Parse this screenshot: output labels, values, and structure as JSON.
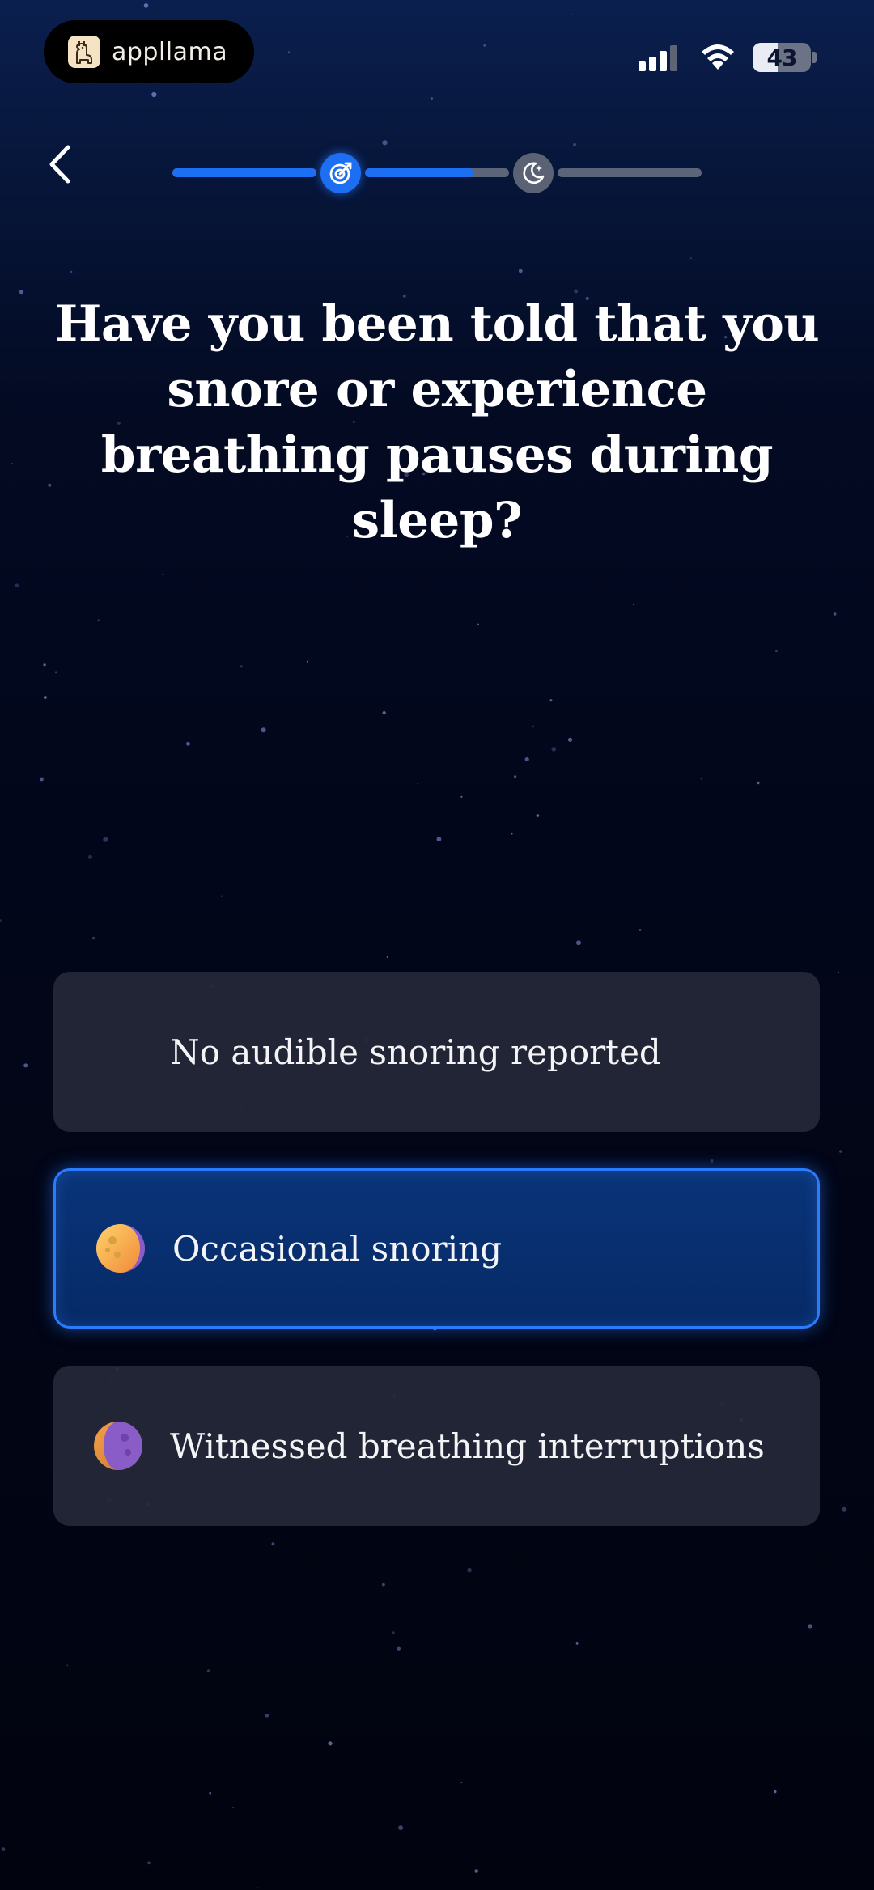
{
  "status_bar": {
    "brand_name": "appllama",
    "battery_level": "43",
    "signal_icon": "signal-bars-icon",
    "wifi_icon": "wifi-icon"
  },
  "nav": {
    "back_icon": "chevron-left-icon",
    "progress": {
      "segments_fill": [
        1.0,
        0.75,
        0.0
      ],
      "steps": [
        {
          "icon": "target-icon",
          "state": "active"
        },
        {
          "icon": "moon-icon",
          "state": "pending"
        }
      ]
    }
  },
  "question": {
    "text": "Have you been told that you snore or experience breathing pauses during sleep?"
  },
  "options": [
    {
      "label": "No audible snoring reported",
      "icon": "crescent-moon-icon",
      "selected": false
    },
    {
      "label": "Occasional snoring",
      "icon": "gibbous-moon-icon",
      "selected": true
    },
    {
      "label": "Witnessed breathing interruptions",
      "icon": "purple-moon-icon",
      "selected": false
    }
  ],
  "colors": {
    "accent": "#1c6ef2",
    "selected_border": "#2a7cff",
    "option_bg": "#242838",
    "selected_bg": "#062a66"
  }
}
